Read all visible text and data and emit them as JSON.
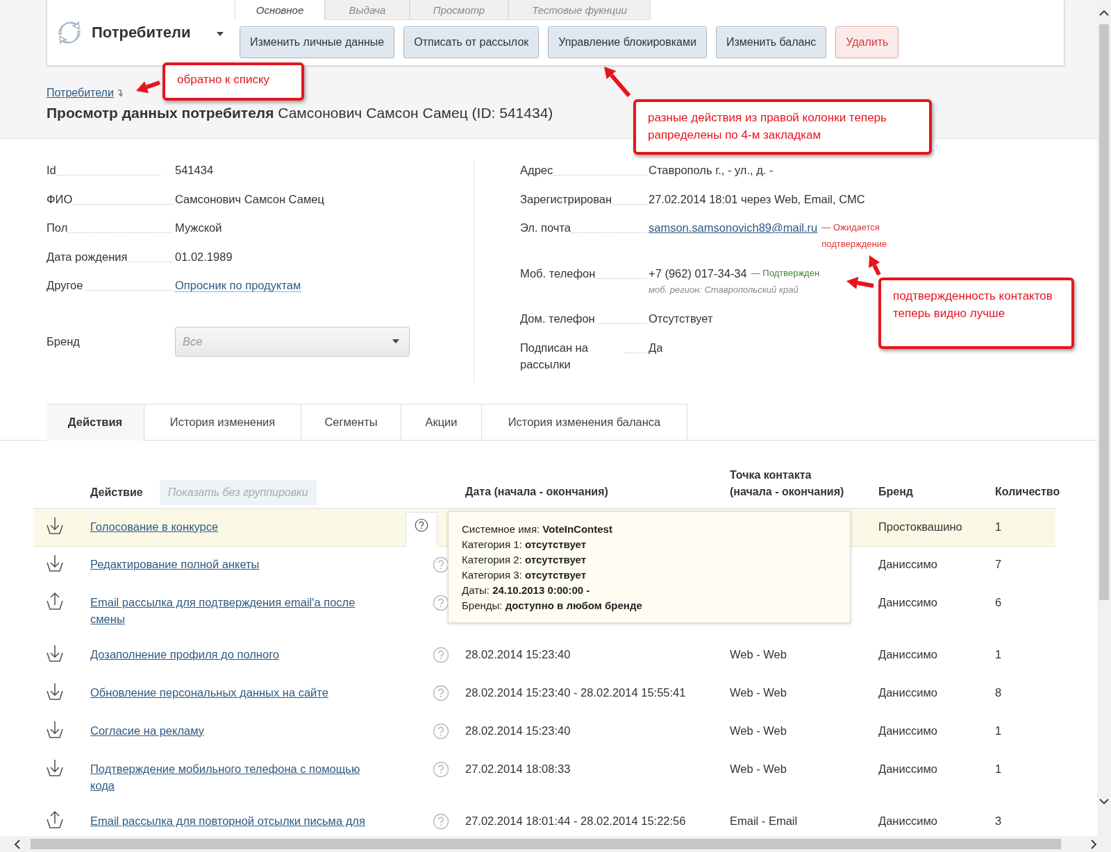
{
  "header": {
    "title": "Потребители",
    "tabs": [
      {
        "label": "Основное",
        "selected": true
      },
      {
        "label": "Выдача",
        "selected": false
      },
      {
        "label": "Просмотр",
        "selected": false
      },
      {
        "label": "Тестовые фукнции",
        "selected": false
      }
    ],
    "buttons": [
      {
        "label": "Изменить личные данные",
        "kind": "normal"
      },
      {
        "label": "Отписать от рассылок",
        "kind": "normal"
      },
      {
        "label": "Управление блокировками",
        "kind": "normal"
      },
      {
        "label": "Изменить баланс",
        "kind": "normal"
      },
      {
        "label": "Удалить",
        "kind": "danger"
      }
    ]
  },
  "breadcrumb": {
    "link": "Потребители"
  },
  "page_title": "**Просмотр данных потребителя** Самсонович Самсон Самец (ID: 541434)",
  "details": {
    "left": [
      {
        "label": "Id",
        "value": "541434",
        "kind": "text"
      },
      {
        "label": "ФИО",
        "value": "Самсонович Самсон Самец",
        "kind": "text"
      },
      {
        "label": "Пол",
        "value": "Мужской",
        "kind": "text"
      },
      {
        "label": "Дата рождения",
        "value": "01.02.1989",
        "kind": "text"
      },
      {
        "label": "Другое",
        "value": "Опросник по продуктам",
        "kind": "dotted-link"
      }
    ],
    "brand": {
      "label": "Бренд",
      "value": "Все"
    },
    "right": [
      {
        "label": "Адрес",
        "value": "Ставрополь г., - ул., д. -",
        "kind": "text"
      },
      {
        "label": "Зарегистрирован",
        "value": "27.02.2014 18:01 через Web, Email, СМС",
        "kind": "text"
      },
      {
        "label": "Эл. почта",
        "value": "samson.samsonovich89@mail.ru",
        "kind": "link",
        "status": {
          "text": "— Ожидается подтверждение",
          "confirmed": false
        }
      },
      {
        "label": "Моб. телефон",
        "value": "+7 (962) 017-34-34",
        "kind": "text",
        "status": {
          "text": "— Подтвержден",
          "confirmed": true
        },
        "note": "моб. регион: Ставропольский край"
      },
      {
        "label": "Дом. телефон",
        "value": "Отсутствует",
        "kind": "text"
      },
      {
        "label": "Подписан на рассылки",
        "value": "Да",
        "kind": "text"
      }
    ]
  },
  "section_tabs": [
    {
      "label": "Действия",
      "selected": true
    },
    {
      "label": "История изменения",
      "selected": false
    },
    {
      "label": "Сегменты",
      "selected": false
    },
    {
      "label": "Акции",
      "selected": false
    },
    {
      "label": "История изменения баланса",
      "selected": false
    }
  ],
  "table": {
    "columns": [
      "Действие",
      "Дата (начала - окончания)",
      "Точка контакта (начала - окончания)",
      "Бренд",
      "Количество"
    ],
    "group_toggle": "Показать без группировки",
    "rows": [
      {
        "kind": "in",
        "action": "Голосование в конкурсе",
        "brand": "Простоквашино",
        "count": "1",
        "selected": true
      },
      {
        "kind": "in",
        "action": "Редактирование полной анкеты",
        "brand": "Даниссимо",
        "count": "7",
        "selected": false
      },
      {
        "kind": "out",
        "action": "Email рассылка для подтверждения email'a после смены",
        "brand": "Даниссимо",
        "count": "6",
        "selected": false
      },
      {
        "kind": "in",
        "action": "Дозаполнение профиля до полного",
        "date": "28.02.2014 15:23:40",
        "contact": "Web - Web",
        "brand": "Даниссимо",
        "count": "1",
        "selected": false
      },
      {
        "kind": "in",
        "action": "Обновление персональных данных на сайте",
        "date": "28.02.2014 15:23:40 - 28.02.2014 15:55:41",
        "contact": "Web - Web",
        "brand": "Даниссимо",
        "count": "8",
        "selected": false
      },
      {
        "kind": "in",
        "action": "Согласие на рекламу",
        "date": "28.02.2014 15:23:40",
        "contact": "Web - Web",
        "brand": "Даниссимо",
        "count": "1",
        "selected": false
      },
      {
        "kind": "in",
        "action": "Подтверждение мобильного телефона с помощью кода",
        "date": "27.02.2014 18:08:33",
        "contact": "Web - Web",
        "brand": "Даниссимо",
        "count": "1",
        "selected": false
      },
      {
        "kind": "out",
        "action": "Email рассылка для повторной отсылки письма для",
        "date": "27.02.2014 18:01:44 - 28.02.2014 15:22:56",
        "contact": "Email - Email",
        "brand": "Даниссимо",
        "count": "3",
        "selected": false
      }
    ]
  },
  "tooltip": {
    "lines": [
      "Системное имя: **VoteInContest**",
      "Категория 1: **отсутствует**",
      "Категория 2: **отсутствует**",
      "Категория 3: **отсутствует**",
      "Даты: **24.10.2013 0:00:00 -**",
      "Бренды: **доступно в любом бренде**"
    ]
  },
  "annotations": [
    {
      "text": "обратно к списку"
    },
    {
      "text": "разные действия из правой колонки теперь рапределены по 4-м закладкам"
    },
    {
      "text": "подтвержденность контактов теперь видно лучше"
    }
  ]
}
